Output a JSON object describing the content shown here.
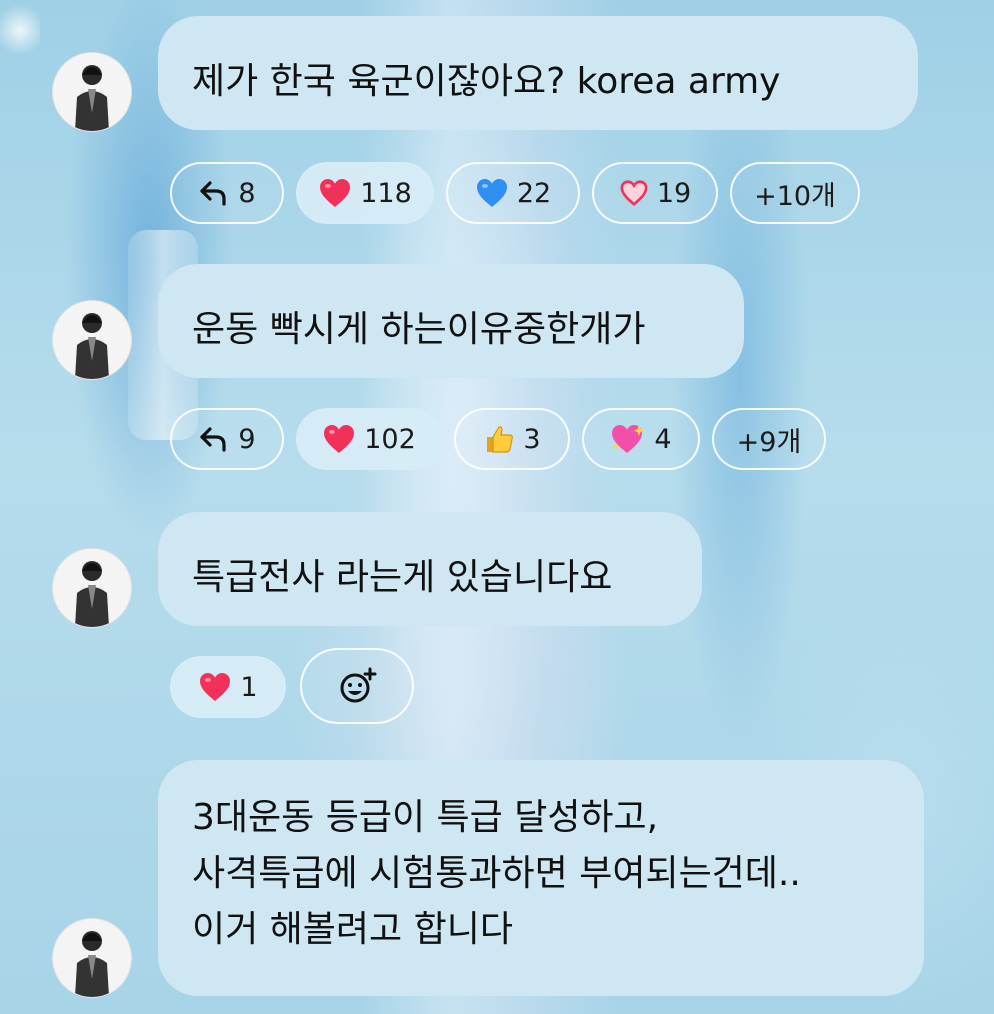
{
  "messages": [
    {
      "text_lines": [
        "제가 한국 육군이잖아요? korea army"
      ],
      "reactions": [
        {
          "icon": "reply-icon",
          "count": "8"
        },
        {
          "icon": "red-heart-icon",
          "count": "118"
        },
        {
          "icon": "blue-heart-icon",
          "count": "22"
        },
        {
          "icon": "outlined-heart-icon",
          "count": "19"
        }
      ],
      "more": "+10개"
    },
    {
      "text_lines": [
        "운동 빡시게 하는이유중한개가"
      ],
      "reactions": [
        {
          "icon": "reply-icon",
          "count": "9"
        },
        {
          "icon": "red-heart-icon",
          "count": "102"
        },
        {
          "icon": "thumbs-up-icon",
          "count": "3"
        },
        {
          "icon": "sparkling-heart-icon",
          "count": "4"
        }
      ],
      "more": "+9개"
    },
    {
      "text_lines": [
        "특급전사 라는게 있습니다요"
      ],
      "reactions": [
        {
          "icon": "red-heart-icon",
          "count": "1"
        }
      ],
      "add_reaction_icon": "add-emoji-icon"
    },
    {
      "text_lines": [
        "3대운동 등급이 특급 달성하고,",
        "사격특급에 시험통과하면 부여되는건데..",
        "이거 해볼려고 합니다"
      ]
    }
  ],
  "colors": {
    "bubble": "#cfe7f2",
    "red_heart": "#f2315a",
    "blue_heart": "#2f8ef2",
    "background": "#a9d3e6"
  }
}
